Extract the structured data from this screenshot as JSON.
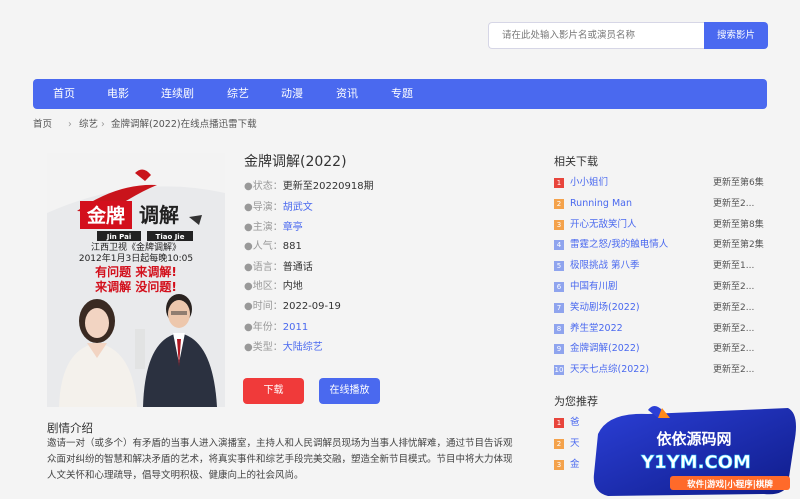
{
  "search": {
    "placeholder": "请在此处输入影片名或演员名称",
    "button": "搜索影片"
  },
  "nav": [
    "首页",
    "电影",
    "连续剧",
    "综艺",
    "动漫",
    "资讯",
    "专题"
  ],
  "breadcrumb": {
    "home": "首页",
    "sep": "›",
    "category": "综艺",
    "current": "金牌调解(2022)在线点播迅雷下载"
  },
  "poster": {
    "brand": "金牌调解",
    "pinyin_1": "Jin Pai",
    "pinyin_2": "Tiao Jie",
    "line1": "江西卫视《金牌调解》",
    "line2": "2012年1月3日起每晚10:05",
    "slogan1": "有问题 来调解!",
    "slogan2": "来调解 没问题!"
  },
  "detail": {
    "title": "金牌调解(2022)",
    "status_label": "●状态：",
    "status": "更新至20220918期",
    "director_label": "●导演：",
    "director": "胡武文",
    "cast_label": "●主演：",
    "cast": "章亭",
    "popularity_label": "●人气：",
    "popularity": "881",
    "language_label": "●语言：",
    "language": "普通话",
    "region_label": "●地区：",
    "region": "内地",
    "time_label": "●时间：",
    "time": "2022-09-19",
    "year_label": "●年份：",
    "year": "2011",
    "type_label": "●类型：",
    "type": "大陆综艺"
  },
  "buttons": {
    "download": "下载",
    "play": "在线播放"
  },
  "plot": {
    "title": "剧情介绍",
    "text": "邀请一对（或多个）有矛盾的当事人进入演播室，主持人和人民调解员现场为当事人排忧解难，通过节目告诉观众面对纠纷的智慧和解决矛盾的艺术，将真实事件和综艺手段完美交融，塑造全新节目模式。节目中将大力体现人文关怀和心理疏导，倡导文明积极、健康向上的社会风尚。"
  },
  "related": {
    "title": "相关下载",
    "items": [
      {
        "num": "1",
        "name": "小小姐们",
        "status": "更新至第6集"
      },
      {
        "num": "2",
        "name": "Running Man",
        "status": "更新至2..."
      },
      {
        "num": "3",
        "name": "开心无敌笑门人",
        "status": "更新至第8集"
      },
      {
        "num": "4",
        "name": "雷霆之怒/我的触电情人",
        "status": "更新至第2集"
      },
      {
        "num": "5",
        "name": "极限挑战 第八季",
        "status": "更新至1..."
      },
      {
        "num": "6",
        "name": "中国有川剧",
        "status": "更新至2..."
      },
      {
        "num": "7",
        "name": "笑动剧场(2022)",
        "status": "更新至2..."
      },
      {
        "num": "8",
        "name": "养生堂2022",
        "status": "更新至2..."
      },
      {
        "num": "9",
        "name": "金牌调解(2022)",
        "status": "更新至2..."
      },
      {
        "num": "10",
        "name": "天天七点综(2022)",
        "status": "更新至2..."
      }
    ]
  },
  "recommend": {
    "title": "为您推荐",
    "items": [
      {
        "num": "1",
        "name": "爸"
      },
      {
        "num": "2",
        "name": "天"
      },
      {
        "num": "3",
        "name": "金"
      }
    ]
  },
  "watermark": {
    "line1": "依依源码网",
    "line2": "Y1YM.COM",
    "line3": "软件|游戏|小程序|棋牌"
  },
  "colors": {
    "accent": "#4a69ef",
    "danger": "#f03a3a",
    "rank_top": "#e8453c",
    "rank_mid": "#f4a24b",
    "rank_rest": "#8fa4ee"
  }
}
